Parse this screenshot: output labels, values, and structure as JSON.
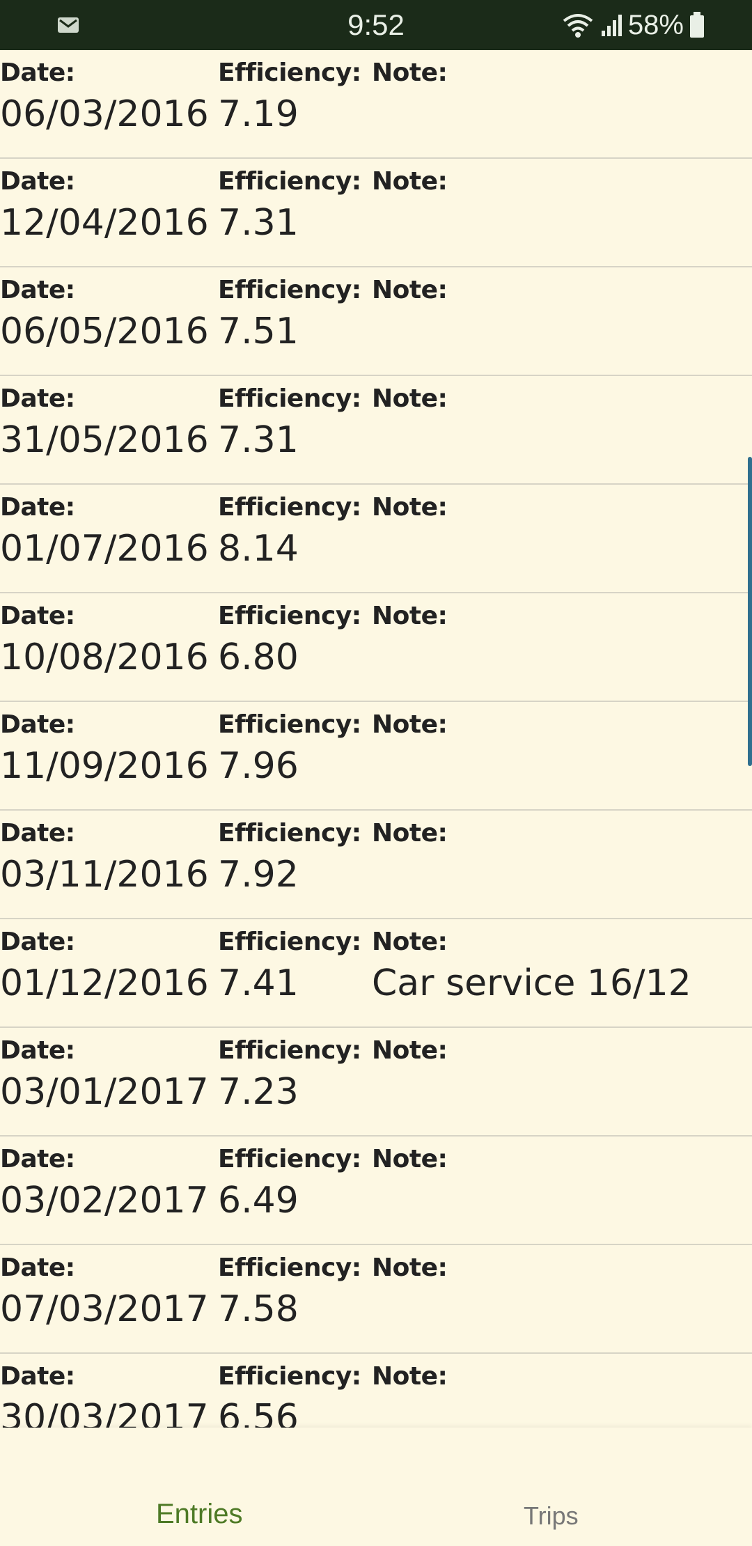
{
  "status_bar": {
    "time": "9:52",
    "battery": "58%",
    "icons": [
      "mail-icon",
      "wifi-icon",
      "signal-icon",
      "battery-icon"
    ]
  },
  "labels": {
    "date": "Date:",
    "efficiency": "Efficiency:",
    "note": "Note:"
  },
  "entries": [
    {
      "date": "06/03/2016",
      "efficiency": "7.19",
      "note": ""
    },
    {
      "date": "12/04/2016",
      "efficiency": "7.31",
      "note": ""
    },
    {
      "date": "06/05/2016",
      "efficiency": "7.51",
      "note": ""
    },
    {
      "date": "31/05/2016",
      "efficiency": "7.31",
      "note": ""
    },
    {
      "date": "01/07/2016",
      "efficiency": "8.14",
      "note": ""
    },
    {
      "date": "10/08/2016",
      "efficiency": "6.80",
      "note": ""
    },
    {
      "date": "11/09/2016",
      "efficiency": "7.96",
      "note": ""
    },
    {
      "date": "03/11/2016",
      "efficiency": "7.92",
      "note": ""
    },
    {
      "date": "01/12/2016",
      "efficiency": "7.41",
      "note": "Car service 16/12"
    },
    {
      "date": "03/01/2017",
      "efficiency": "7.23",
      "note": ""
    },
    {
      "date": "03/02/2017",
      "efficiency": "6.49",
      "note": ""
    },
    {
      "date": "07/03/2017",
      "efficiency": "7.58",
      "note": ""
    },
    {
      "date": "30/03/2017",
      "efficiency": "6.56",
      "note": ""
    }
  ],
  "bottom_nav": {
    "tabs": [
      {
        "label": "Entries",
        "active": true
      },
      {
        "label": "Trips",
        "active": false
      }
    ]
  },
  "colors": {
    "background": "#fdf8e3",
    "status_bar": "#1b2b19",
    "active_tab": "#4e7a26",
    "inactive_tab": "#777777",
    "scrollbar": "#2f6f8f"
  }
}
